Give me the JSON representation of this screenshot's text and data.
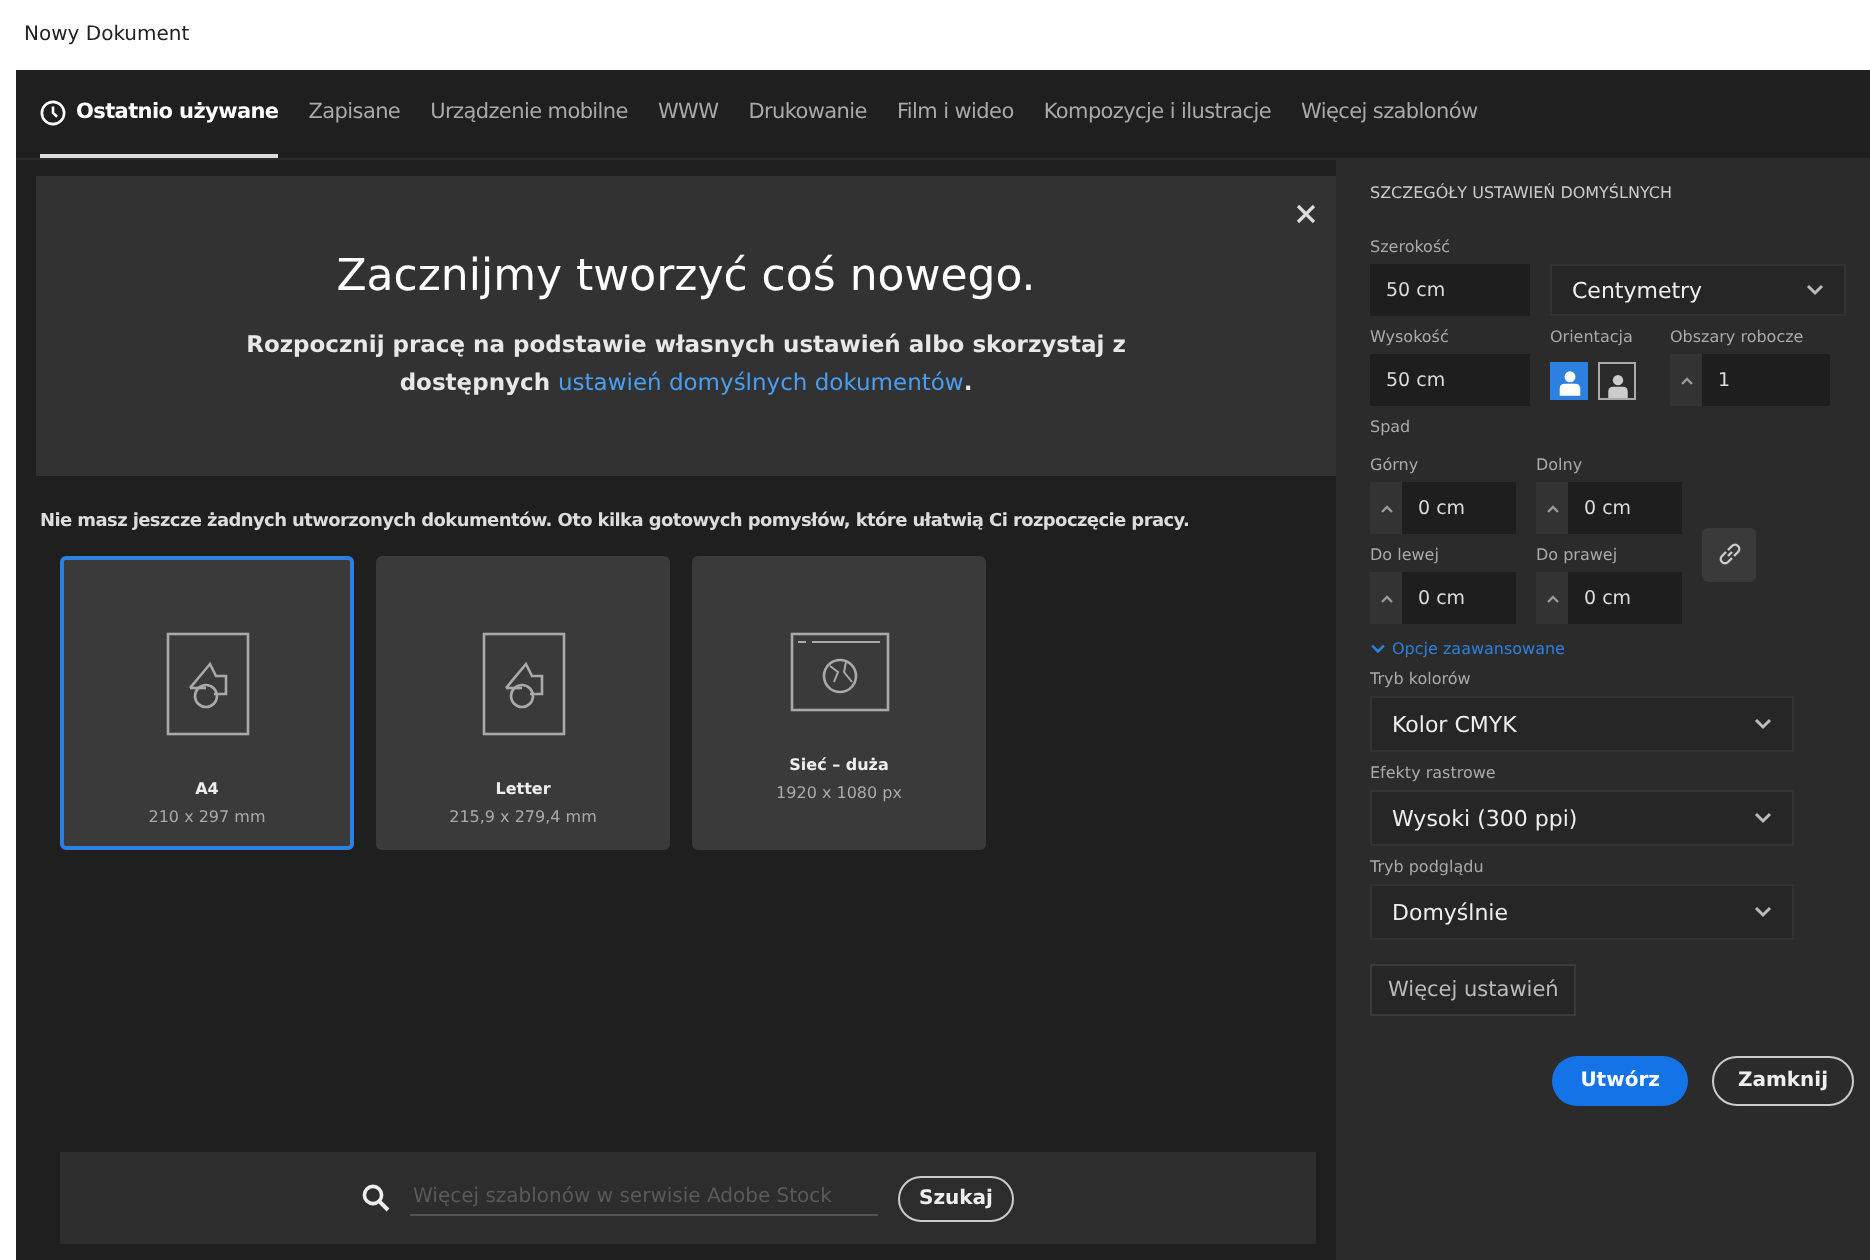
{
  "window": {
    "title": "Nowy Dokument"
  },
  "tabs": [
    {
      "label": "Ostatnio używane",
      "selected": true,
      "kind": "recent"
    },
    {
      "label": "Zapisane",
      "selected": false,
      "kind": "category"
    },
    {
      "label": "Urządzenie mobilne",
      "selected": false,
      "kind": "category"
    },
    {
      "label": "WWW",
      "selected": false,
      "kind": "category"
    },
    {
      "label": "Drukowanie",
      "selected": false,
      "kind": "category"
    },
    {
      "label": "Film i wideo",
      "selected": false,
      "kind": "category"
    },
    {
      "label": "Kompozycje i ilustracje",
      "selected": false,
      "kind": "category"
    },
    {
      "label": "Więcej szablonów",
      "selected": false,
      "kind": "category"
    }
  ],
  "hero": {
    "heading": "Zacznijmy tworzyć coś nowego.",
    "text_before": "Rozpocznij pracę na podstawie własnych ustawień albo skorzystaj z dostępnych",
    "link": "ustawień domyślnych dokumentów",
    "text_after": "."
  },
  "intro": "Nie masz jeszcze żadnych utworzonych dokumentów. Oto kilka gotowych pomysłów, które ułatwią Ci rozpoczęcie pracy.",
  "presets": [
    {
      "name": "A4",
      "size": "210 x 297 mm",
      "kind": "print",
      "selected": true
    },
    {
      "name": "Letter",
      "size": "215,9 x 279,4 mm",
      "kind": "print",
      "selected": false
    },
    {
      "name": "Sieć – duża",
      "size": "1920 x 1080 px",
      "kind": "web",
      "selected": false
    }
  ],
  "search": {
    "placeholder": "Więcej szablonów w serwisie Adobe Stock",
    "button": "Szukaj"
  },
  "details": {
    "heading": "SZCZEGÓŁY USTAWIEŃ DOMYŚLNYCH",
    "width_label": "Szerokość",
    "width": "50 cm",
    "unit": "Centymetry",
    "height_label": "Wysokość",
    "height": "50 cm",
    "orientation_label": "Orientacja",
    "orientations": [
      {
        "kind": "portrait",
        "selected": true
      },
      {
        "kind": "landscape",
        "selected": false
      }
    ],
    "artboards_label": "Obszary robocze",
    "artboards": "1",
    "bleed_label": "Spad",
    "bleeds": [
      {
        "label": "Górny",
        "value": "0 cm"
      },
      {
        "label": "Dolny",
        "value": "0 cm"
      },
      {
        "label": "Do lewej",
        "value": "0 cm"
      },
      {
        "label": "Do prawej",
        "value": "0 cm"
      }
    ],
    "advanced": "Opcje zaawansowane",
    "selects": [
      {
        "label": "Tryb kolorów",
        "value": "Kolor CMYK"
      },
      {
        "label": "Efekty rastrowe",
        "value": "Wysoki (300 ppi)"
      },
      {
        "label": "Tryb podglądu",
        "value": "Domyślnie"
      }
    ],
    "more": "Więcej ustawień"
  },
  "buttons": [
    {
      "label": "Utwórz",
      "kind": "primary"
    },
    {
      "label": "Zamknij",
      "kind": "secondary"
    }
  ]
}
